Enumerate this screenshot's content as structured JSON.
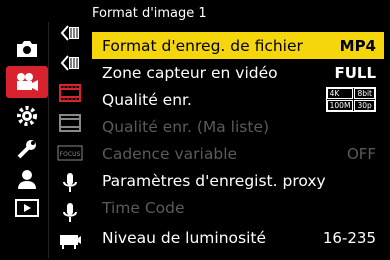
{
  "header": {
    "title": "Format d'image 1"
  },
  "menu": {
    "items": [
      {
        "label": "Format d'enreg. de fichier",
        "value": "MP4",
        "state": "selected"
      },
      {
        "label": "Zone capteur en vidéo",
        "value": "FULL",
        "state": "normal"
      },
      {
        "label": "Qualité enr.",
        "value": "",
        "state": "normal"
      },
      {
        "label": "Qualité enr. (Ma liste)",
        "value": "",
        "state": "disabled"
      },
      {
        "label": "Cadence variable",
        "value": "OFF",
        "state": "disabled"
      },
      {
        "label": "Paramètres d'enregist. proxy",
        "value": "",
        "state": "normal"
      },
      {
        "label": "Time Code",
        "value": "",
        "state": "disabled"
      },
      {
        "label": "Niveau de luminosité",
        "value": "16-235",
        "state": "normal"
      }
    ],
    "quality_badge": {
      "res": "4K",
      "bit": "8bit",
      "rate": "100M",
      "fps": "30p"
    }
  },
  "sub_tabs": {
    "focus_label": "FOCUS"
  },
  "colors": {
    "accent": "#d8222e",
    "highlight": "#f5d60c"
  }
}
